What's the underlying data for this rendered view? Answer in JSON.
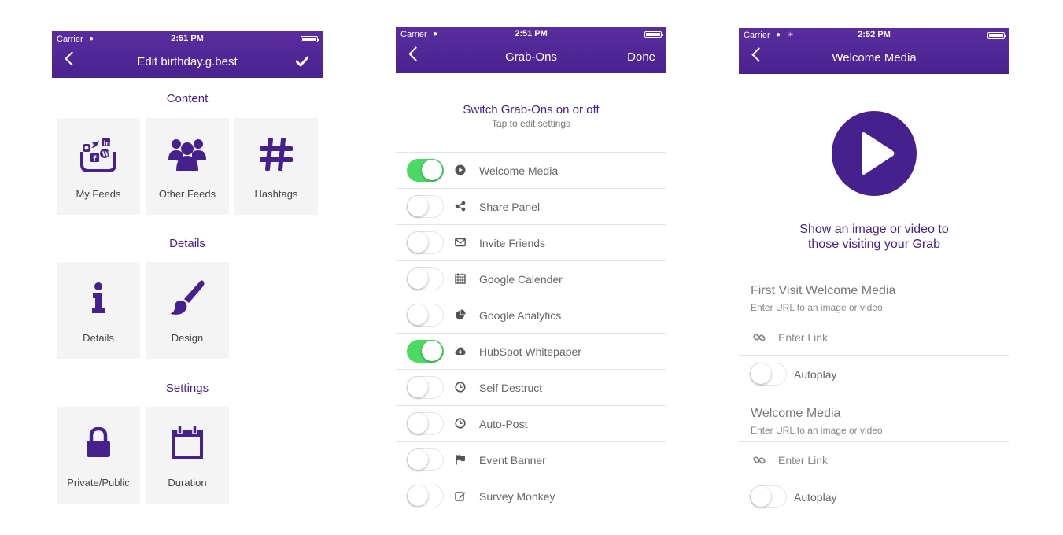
{
  "screen1": {
    "status": {
      "carrier": "Carrier",
      "time": "2:51 PM"
    },
    "nav": {
      "title": "Edit birthday.g.best"
    },
    "sections": {
      "content": "Content",
      "details": "Details",
      "settings": "Settings"
    },
    "tiles": {
      "my_feeds": "My Feeds",
      "other_feeds": "Other Feeds",
      "hashtags": "Hashtags",
      "details": "Details",
      "design": "Design",
      "private_public": "Private/Public",
      "duration": "Duration"
    }
  },
  "screen2": {
    "status": {
      "carrier": "Carrier",
      "time": "2:51 PM"
    },
    "nav": {
      "title": "Grab-Ons",
      "done": "Done"
    },
    "headline": "Switch Grab-Ons on or off",
    "subline": "Tap to edit settings",
    "items": [
      {
        "label": "Welcome Media",
        "on": true,
        "icon": "play-circle-icon"
      },
      {
        "label": "Share Panel",
        "on": false,
        "icon": "share-icon"
      },
      {
        "label": "Invite Friends",
        "on": false,
        "icon": "envelope-icon"
      },
      {
        "label": "Google Calender",
        "on": false,
        "icon": "calendar-icon"
      },
      {
        "label": "Google Analytics",
        "on": false,
        "icon": "pie-chart-icon"
      },
      {
        "label": "HubSpot Whitepaper",
        "on": true,
        "icon": "cloud-download-icon"
      },
      {
        "label": "Self Destruct",
        "on": false,
        "icon": "clock-icon"
      },
      {
        "label": "Auto-Post",
        "on": false,
        "icon": "clock-icon"
      },
      {
        "label": "Event Banner",
        "on": false,
        "icon": "flag-icon"
      },
      {
        "label": "Survey Monkey",
        "on": false,
        "icon": "edit-icon"
      }
    ]
  },
  "screen3": {
    "status": {
      "carrier": "Carrier",
      "time": "2:52 PM"
    },
    "nav": {
      "title": "Welcome Media"
    },
    "prompt_line1": "Show an image or video to",
    "prompt_line2": "those visiting your Grab",
    "first_visit": {
      "title": "First Visit Welcome Media",
      "subtitle": "Enter URL to an image or video",
      "link_placeholder": "Enter Link",
      "autoplay_label": "Autoplay",
      "autoplay_on": false
    },
    "welcome": {
      "title": "Welcome Media",
      "subtitle": "Enter URL to an image or video",
      "link_placeholder": "Enter Link",
      "autoplay_label": "Autoplay",
      "autoplay_on": false
    }
  },
  "colors": {
    "brand_purple": "#46208c",
    "nav_purple": "#5a2d9e",
    "toggle_on": "#4cd964",
    "tile_bg": "#f4f4f4"
  }
}
